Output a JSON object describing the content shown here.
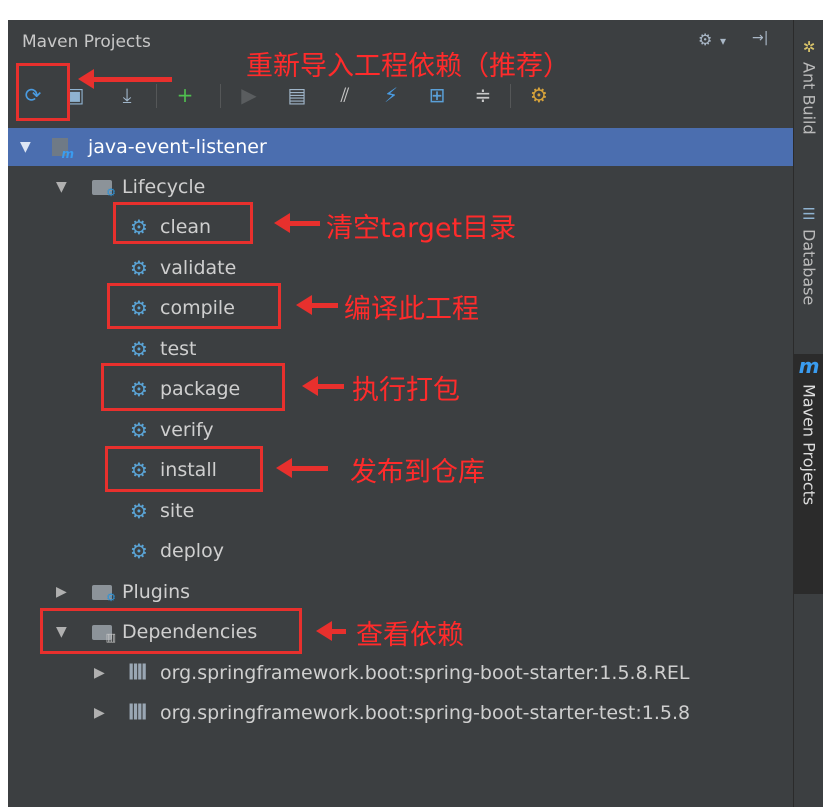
{
  "panel": {
    "title": "Maven Projects",
    "settings_icon": "gear-icon",
    "settings_caret": "▾",
    "hide_icon": "→|"
  },
  "toolbar": {
    "buttons": [
      {
        "name": "reimport-button",
        "glyph": "⟳",
        "color": "#4a9be0"
      },
      {
        "name": "generate-sources-button",
        "glyph": "▣",
        "color": "#8fb3d1"
      },
      {
        "name": "download-sources-button",
        "glyph": "⤓",
        "color": "#9fb5c9"
      },
      {
        "name": "add-maven-project-button",
        "glyph": "+",
        "color": "#4fbf4f"
      },
      {
        "name": "run-maven-build-button",
        "glyph": "▶",
        "color": "#5a5d5f"
      },
      {
        "name": "execute-goal-button",
        "glyph": "▤",
        "color": "#9fb5c9"
      },
      {
        "name": "toggle-offline-button",
        "glyph": "⫽",
        "color": "#c8c8c8"
      },
      {
        "name": "skip-tests-button",
        "glyph": "⚡",
        "color": "#4a9be0"
      },
      {
        "name": "show-dependencies-button",
        "glyph": "⊞",
        "color": "#5aa0d8"
      },
      {
        "name": "collapse-all-button",
        "glyph": "≑",
        "color": "#c8c8c8"
      },
      {
        "name": "maven-settings-button",
        "glyph": "⚙",
        "color": "#d6a23a"
      }
    ]
  },
  "tree": {
    "project": "java-event-listener",
    "lifecycle_label": "Lifecycle",
    "phases": [
      "clean",
      "validate",
      "compile",
      "test",
      "package",
      "verify",
      "install",
      "site",
      "deploy"
    ],
    "plugins_label": "Plugins",
    "dependencies_label": "Dependencies",
    "dependencies": [
      "org.springframework.boot:spring-boot-starter:1.5.8.REL",
      "org.springframework.boot:spring-boot-starter-test:1.5.8"
    ]
  },
  "side_tabs": [
    {
      "label": "Ant Build",
      "icon": "ant-icon"
    },
    {
      "label": "Database",
      "icon": "database-icon"
    },
    {
      "label": "Maven Projects",
      "icon": "maven-icon",
      "glyph": "m"
    }
  ],
  "annotations": {
    "reimport": "重新导入工程依赖（推荐）",
    "clean": "清空target目录",
    "compile": "编译此工程",
    "package": "执行打包",
    "install": "发布到仓库",
    "dependencies": "查看依赖"
  },
  "colors": {
    "panel_bg": "#3c3f41",
    "selection": "#4b6eaf",
    "annotation_red": "#e8302d"
  }
}
